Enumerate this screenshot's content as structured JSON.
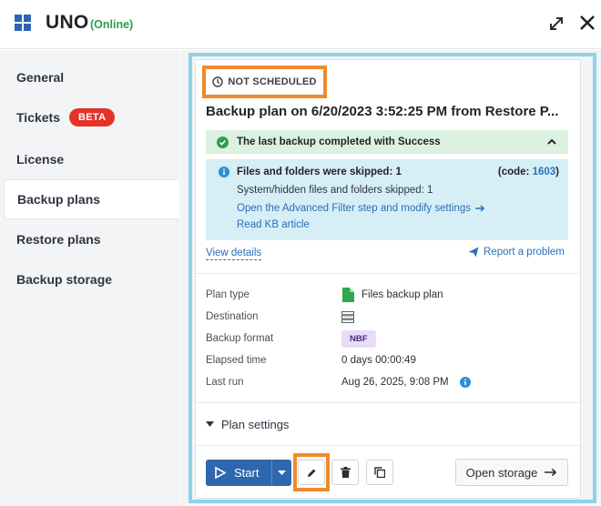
{
  "app": {
    "title": "UNO",
    "status": "(Online)"
  },
  "sidebar": {
    "items": [
      {
        "label": "General"
      },
      {
        "label": "Tickets",
        "badge": "BETA"
      },
      {
        "label": "License"
      },
      {
        "label": "Backup plans",
        "active": true
      },
      {
        "label": "Restore plans"
      },
      {
        "label": "Backup storage"
      }
    ]
  },
  "plan": {
    "status": "NOT SCHEDULED",
    "title": "Backup plan on 6/20/2023 3:52:25 PM from Restore P...",
    "success_message": "The last backup completed with Success",
    "warning": {
      "title": "Files and folders were skipped: 1",
      "code_label": "(code: ",
      "code": "1603",
      "code_suffix": ")",
      "detail": "System/hidden files and folders skipped: 1",
      "link_filter": "Open the Advanced Filter step and modify settings",
      "link_kb": "Read KB article"
    },
    "view_details": "View details",
    "report_problem": "Report a problem",
    "properties": {
      "plan_type_label": "Plan type",
      "plan_type_value": "Files backup plan",
      "destination_label": "Destination",
      "format_label": "Backup format",
      "format_value": "NBF",
      "elapsed_label": "Elapsed time",
      "elapsed_value": "0 days 00:00:49",
      "last_run_label": "Last run",
      "last_run_value": "Aug 26, 2025, 9:08 PM"
    },
    "plan_settings": "Plan settings"
  },
  "actions": {
    "start": "Start",
    "open_storage": "Open storage"
  },
  "colors": {
    "accent": "#2e67ad",
    "success": "#2e9e4f",
    "highlight": "#f08a2b",
    "badge": "#e5332a"
  }
}
